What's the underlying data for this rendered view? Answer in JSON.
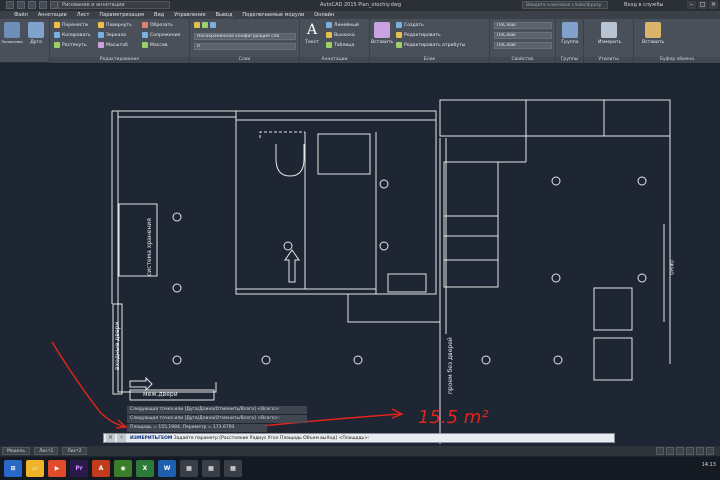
{
  "titlebar": {
    "workspace": "Рисование и аннотации",
    "title": "AutoCAD 2015    Plan_otochiy.dwg",
    "search_placeholder": "Введите ключевое слово/фразу",
    "signin": "Вход в службы"
  },
  "menu": [
    "Файл",
    "Аннотации",
    "Лист",
    "Параметризация",
    "Вид",
    "Управление",
    "Вывод",
    "Подключаемые модули",
    "Онлайн"
  ],
  "ribbon": {
    "draw": {
      "line": "Отрезок",
      "polyline": "Полилиния",
      "circle": "Круг",
      "arc": "Дуга"
    },
    "modify": {
      "title": "Редактирование",
      "move": "Перенести",
      "copy": "Копировать",
      "stretch": "Растянуть",
      "rotate": "Повернуть",
      "mirror": "Зеркало",
      "scale": "Масштаб",
      "trim": "Обрезать",
      "fillet": "Сопряжение",
      "array": "Массив"
    },
    "layers": {
      "title": "Слои",
      "layer_dropdown": "Несохраненная конфигурация сло",
      "layer_value": "0"
    },
    "annotation": {
      "title": "Аннотации",
      "text": "Текст",
      "dim": "Линейный",
      "leader": "Выноска",
      "table": "Таблица"
    },
    "block": {
      "title": "Блок",
      "insert": "Вставить",
      "create": "Создать",
      "edit": "Редактировать",
      "edit_attr": "Редактировать атрибуты"
    },
    "properties": {
      "title": "Свойства",
      "color": "ПоСлою",
      "linetype": "ПоСлою",
      "lineweight": "ПоСлою"
    },
    "groups": {
      "title": "Группы",
      "label": "Группа"
    },
    "utilities": {
      "title": "Утилиты",
      "measure": "Измерить"
    },
    "clipboard": {
      "title": "Буфер обмена",
      "paste": "Вставить"
    }
  },
  "drawing": {
    "label_storage": "система хранения",
    "label_entry_door": "входные двери",
    "label_interior_door": "меж.двери",
    "label_no_door": "проем без дверей",
    "label_window": "окно",
    "handwritten_area": "15.5 m²"
  },
  "command": {
    "history": [
      "Следующая точка или [Дуга/Длина/Отменить/Всего] <Всего>:",
      "Следующая точка или [Дуга/Длина/Отменить/Всего] <Всего>:",
      "Площадь = 155.1984, Периметр = 173.6793"
    ],
    "prompt_cmd": "ИЗМЕРИТЬГЕОМ",
    "prompt_text": "Задайте параметр [Расстояние Радиус Угол Площадь Объем выХод] <Площадь>:"
  },
  "layout_tabs": [
    "Модель",
    "Лист1",
    "Лист2"
  ],
  "taskbar": {
    "clock": "14:13"
  },
  "colors": {
    "accent_red": "#e0261c",
    "drawing_bg": "#1e2533",
    "lines": "#e6e6e6"
  }
}
